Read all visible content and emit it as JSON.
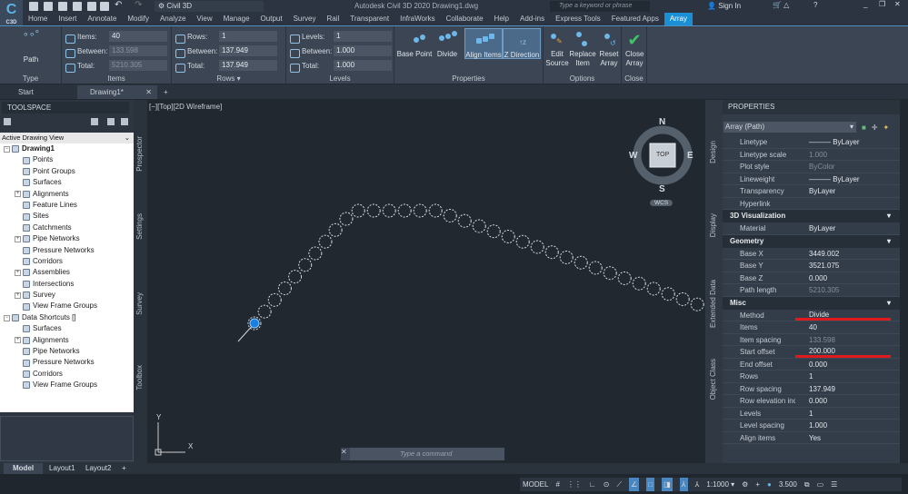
{
  "app": {
    "workspace": "Civil 3D",
    "title": "Autodesk Civil 3D 2020   Drawing1.dwg",
    "search_placeholder": "Type a keyword or phrase",
    "sign_in": "Sign In",
    "logo": "C3D"
  },
  "menu": [
    "Home",
    "Insert",
    "Annotate",
    "Modify",
    "Analyze",
    "View",
    "Manage",
    "Output",
    "Survey",
    "Rail",
    "Transparent",
    "InfraWorks",
    "Collaborate",
    "Help",
    "Add-ins",
    "Express Tools",
    "Featured Apps",
    "Array"
  ],
  "menu_active": "Array",
  "ribbon": {
    "type": {
      "button": "Path",
      "title": "Type"
    },
    "items": {
      "title": "Items",
      "items_label": "Items:",
      "items": "40",
      "between_label": "Between:",
      "between": "133.598",
      "total_label": "Total:",
      "total": "5210.305"
    },
    "rows": {
      "title": "Rows ▾",
      "rows_label": "Rows:",
      "rows": "1",
      "between_label": "Between:",
      "between": "137.949",
      "total_label": "Total:",
      "total": "137.949"
    },
    "levels": {
      "title": "Levels",
      "levels_label": "Levels:",
      "levels": "1",
      "between_label": "Between:",
      "between": "1.000",
      "total_label": "Total:",
      "total": "1.000"
    },
    "properties": {
      "title": "Properties",
      "base_point": "Base Point",
      "divide": "Divide",
      "align_items": "Align Items",
      "z_direction": "Z Direction"
    },
    "options": {
      "title": "Options",
      "edit_source": "Edit Source",
      "replace_item": "Replace Item",
      "reset_array": "Reset Array"
    },
    "close": {
      "title": "Close",
      "close_array": "Close Array"
    }
  },
  "doc_tabs": [
    "Start",
    "Drawing1*"
  ],
  "toolspace": {
    "title": "TOOLSPACE",
    "view": "Active Drawing View",
    "tree": [
      {
        "label": "Drawing1",
        "level": 0,
        "bold": true,
        "exp": "−"
      },
      {
        "label": "Points",
        "level": 1
      },
      {
        "label": "Point Groups",
        "level": 1
      },
      {
        "label": "Surfaces",
        "level": 1
      },
      {
        "label": "Alignments",
        "level": 1,
        "exp": "+"
      },
      {
        "label": "Feature Lines",
        "level": 1
      },
      {
        "label": "Sites",
        "level": 1
      },
      {
        "label": "Catchments",
        "level": 1
      },
      {
        "label": "Pipe Networks",
        "level": 1,
        "exp": "+"
      },
      {
        "label": "Pressure Networks",
        "level": 1
      },
      {
        "label": "Corridors",
        "level": 1
      },
      {
        "label": "Assemblies",
        "level": 1,
        "exp": "+"
      },
      {
        "label": "Intersections",
        "level": 1
      },
      {
        "label": "Survey",
        "level": 1,
        "exp": "+"
      },
      {
        "label": "View Frame Groups",
        "level": 1
      },
      {
        "label": "Data Shortcuts []",
        "level": 0,
        "exp": "−"
      },
      {
        "label": "Surfaces",
        "level": 1
      },
      {
        "label": "Alignments",
        "level": 1,
        "exp": "+"
      },
      {
        "label": "Pipe Networks",
        "level": 1
      },
      {
        "label": "Pressure Networks",
        "level": 1
      },
      {
        "label": "Corridors",
        "level": 1
      },
      {
        "label": "View Frame Groups",
        "level": 1
      }
    ],
    "side_tabs": [
      "Prospector",
      "Settings",
      "Survey",
      "Toolbox"
    ]
  },
  "viewport": {
    "label": "[−][Top][2D Wireframe]",
    "compass": {
      "n": "N",
      "s": "S",
      "e": "E",
      "w": "W",
      "top": "TOP"
    },
    "wcs": "WCS",
    "ucs_y": "Y",
    "ucs_x": "X",
    "command_placeholder": "Type a command"
  },
  "properties": {
    "title": "PROPERTIES",
    "selection": "Array (Path)",
    "side_tabs": [
      "Design",
      "Display",
      "Extended Data",
      "Object Class"
    ],
    "general": [
      [
        "Linetype",
        "——— ByLayer"
      ],
      [
        "Linetype scale",
        "1.000",
        true
      ],
      [
        "Plot style",
        "ByColor",
        true
      ],
      [
        "Lineweight",
        "——— ByLayer"
      ],
      [
        "Transparency",
        "ByLayer"
      ],
      [
        "Hyperlink",
        ""
      ]
    ],
    "sections": [
      {
        "title": "3D Visualization",
        "rows": [
          [
            "Material",
            "ByLayer"
          ]
        ]
      },
      {
        "title": "Geometry",
        "rows": [
          [
            "Base X",
            "3449.002"
          ],
          [
            "Base Y",
            "3521.075"
          ],
          [
            "Base Z",
            "0.000"
          ],
          [
            "Path length",
            "5210.305",
            true
          ]
        ]
      },
      {
        "title": "Misc",
        "rows": [
          [
            "Method",
            "Divide"
          ],
          [
            "Items",
            "40"
          ],
          [
            "Item spacing",
            "133.598",
            true
          ],
          [
            "Start offset",
            "200.000"
          ],
          [
            "End offset",
            "0.000"
          ],
          [
            "Rows",
            "1"
          ],
          [
            "Row spacing",
            "137.949"
          ],
          [
            "Row elevation incr...",
            "0.000"
          ],
          [
            "Levels",
            "1"
          ],
          [
            "Level spacing",
            "1.000"
          ],
          [
            "Align items",
            "Yes"
          ]
        ]
      }
    ],
    "highlight_color": "#e0191f"
  },
  "layout_tabs": [
    "Model",
    "Layout1",
    "Layout2"
  ],
  "status": {
    "model": "MODEL",
    "scale": "1:1000 ▾",
    "annotation": "3.500"
  },
  "colors": {
    "accent": "#1a8fd6",
    "canvas": "#212830",
    "ribbon": "#3b4553"
  }
}
